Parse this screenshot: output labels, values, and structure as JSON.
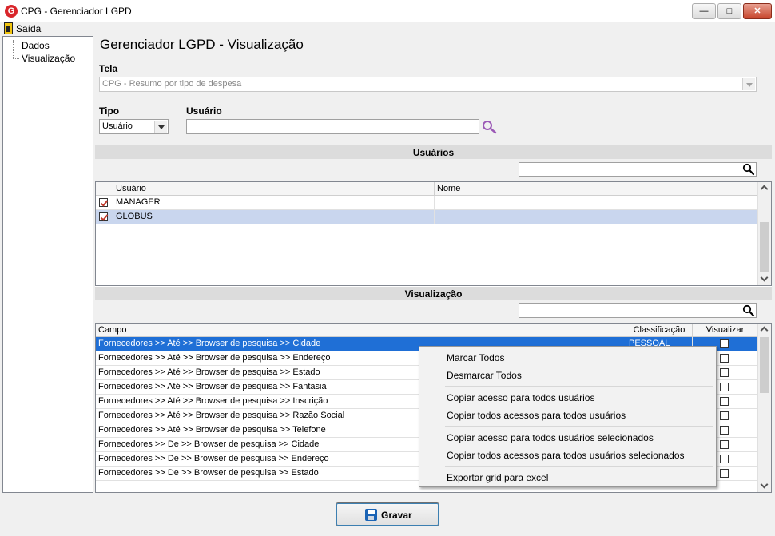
{
  "window": {
    "title": "CPG - Gerenciador LGPD",
    "logo_letter": "G",
    "minimize_glyph": "—",
    "maximize_glyph": "□",
    "close_glyph": "✕"
  },
  "menu": {
    "exit_label": "Saída"
  },
  "tree": {
    "items": [
      "Dados",
      "Visualização"
    ]
  },
  "page_title": "Gerenciador LGPD - Visualização",
  "form": {
    "tela_label": "Tela",
    "tela_value": "CPG - Resumo por tipo de despesa",
    "tipo_label": "Tipo",
    "tipo_value": "Usuário",
    "usuario_label": "Usuário",
    "usuario_value": ""
  },
  "users_section": {
    "header": "Usuários",
    "search_value": "",
    "columns": [
      "Usuário",
      "Nome"
    ],
    "rows": [
      {
        "usuario": "MANAGER",
        "nome": "",
        "checked": true
      },
      {
        "usuario": "GLOBUS",
        "nome": "",
        "checked": true
      }
    ]
  },
  "view_section": {
    "header": "Visualização",
    "search_value": "",
    "columns": [
      "Campo",
      "Classificação",
      "Visualizar"
    ],
    "rows": [
      {
        "campo": "Fornecedores >> Até >> Browser de pesquisa >> Cidade",
        "classificacao": "PESSOAL",
        "visualizar": false
      },
      {
        "campo": "Fornecedores >> Até >> Browser de pesquisa >> Endereço",
        "classificacao": "",
        "visualizar": false
      },
      {
        "campo": "Fornecedores >> Até >> Browser de pesquisa >> Estado",
        "classificacao": "",
        "visualizar": false
      },
      {
        "campo": "Fornecedores >> Até >> Browser de pesquisa >> Fantasia",
        "classificacao": "",
        "visualizar": false
      },
      {
        "campo": "Fornecedores >> Até >> Browser de pesquisa >> Inscrição",
        "classificacao": "",
        "visualizar": false
      },
      {
        "campo": "Fornecedores >> Até >> Browser de pesquisa >> Razão Social",
        "classificacao": "",
        "visualizar": false
      },
      {
        "campo": "Fornecedores >> Até >> Browser de pesquisa >> Telefone",
        "classificacao": "",
        "visualizar": false
      },
      {
        "campo": "Fornecedores >> De >> Browser de pesquisa >> Cidade",
        "classificacao": "",
        "visualizar": false
      },
      {
        "campo": "Fornecedores >> De >> Browser de pesquisa >> Endereço",
        "classificacao": "",
        "visualizar": false
      },
      {
        "campo": "Fornecedores >> De >> Browser de pesquisa >> Estado",
        "classificacao": "",
        "visualizar": false
      }
    ]
  },
  "context_menu": {
    "items": [
      "Marcar Todos",
      "Desmarcar Todos",
      "Copiar acesso para todos usuários",
      "Copiar todos acessos para todos usuários",
      "Copiar acesso para todos usuários selecionados",
      "Copiar todos acessos para todos usuários selecionados",
      "Exportar grid para excel"
    ]
  },
  "buttons": {
    "save_label": "Gravar"
  },
  "colors": {
    "selection": "#1f6fd6",
    "row_selected": "#c9d6ee",
    "logo": "#d9262b",
    "search_icon": "#9b59b6"
  }
}
